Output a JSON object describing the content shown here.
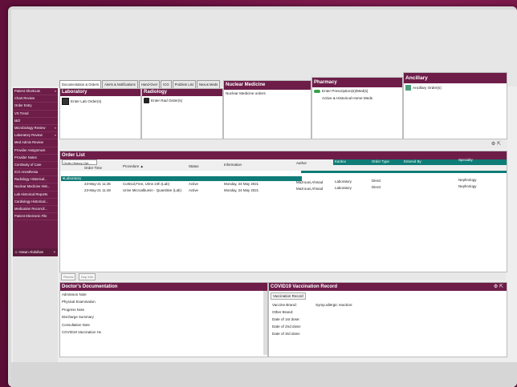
{
  "sidebar": {
    "items": [
      {
        "label": "Patient Shortcuts",
        "chev": "»"
      },
      {
        "label": "Chart Review"
      },
      {
        "label": "Order Entry"
      },
      {
        "label": "VS Trend"
      },
      {
        "label": "I&O"
      },
      {
        "label": "Microbiology Review",
        "chev": "»"
      },
      {
        "label": "Laboratory Review",
        "chev": "»"
      },
      {
        "label": "Med Admin Review"
      },
      {
        "label": "Provider Assignment"
      },
      {
        "label": "Provider Notes"
      },
      {
        "label": "Continuity of Care"
      },
      {
        "label": "ICG Anesthesia"
      },
      {
        "label": "Radiology Historical..."
      },
      {
        "label": "Nuclear Medicine Hist..."
      },
      {
        "label": "Lab Historical Reports"
      },
      {
        "label": "Cardiology Historical..."
      },
      {
        "label": "Medication Reconcil..."
      },
      {
        "label": "Patient Electronic File"
      }
    ],
    "patient": "Hasan Abdulbas",
    "patient_close": "×"
  },
  "tabs": [
    "Documentation & Orders",
    "Alerts & Notifications",
    "Hand-Over",
    "ICG",
    "Problem List",
    "Nexus Meds"
  ],
  "categories": {
    "laboratory": {
      "title": "Laboratory",
      "item": "Enter Lab Order(s)"
    },
    "radiology": {
      "title": "Radiology",
      "item": "Enter Rad Order(s)"
    },
    "nuclear": {
      "title": "Nuclear Medicine",
      "item": "Nuclear Medicine orders"
    },
    "pharmacy": {
      "title": "Pharmacy",
      "item1": "Enter Prescription(s)/Med(s)",
      "item2": "Active & Historical Home Meds"
    },
    "ancillary": {
      "title": "Ancillary",
      "item": "Ancillary Order(s)"
    }
  },
  "toolbar_icons": "⚙ ⇱",
  "order_list": {
    "title": "Order List",
    "filter": "Order History Opt...",
    "headers": {
      "order_time": "Order Time",
      "procedure": "Procedure ▲",
      "status": "Status",
      "information": "Information",
      "author": "Author",
      "kardex": "Kardex",
      "order_type": "Order Type",
      "entered_by": "Entered By",
      "specialty": "Specialty"
    },
    "group": "▾Laboratory",
    "rows": [
      {
        "time": "23-May-21 11:35",
        "procedure": "Cortisol,Free, Urine 24h (Lab)",
        "status": "Active",
        "info": "Monday, 24 May 2021",
        "author": "Mazrouei,Ahmad",
        "kardex": "Laboratory",
        "type": "Direct",
        "specialty": "Nephrology"
      },
      {
        "time": "23-May-21 11:48",
        "procedure": "Urine Microalbumin - Quantitive (Lab)",
        "status": "Active",
        "info": "Monday, 24 May 2021",
        "author": "Mazrouei,Ahmad",
        "kardex": "Laboratory",
        "type": "Direct",
        "specialty": "Nephrology"
      }
    ]
  },
  "bottom_buttons": [
    "Renew",
    "Dup Info"
  ],
  "doc": {
    "title": "Doctor's Documentation",
    "items": [
      "Admission Note",
      "Physical Examination",
      "Progress Note",
      "Discharge Summary",
      "Consultation Note",
      "COVID19 Vaccination Hx"
    ]
  },
  "covid": {
    "title": "COVID19 Vaccination Record",
    "tab": "Vaccination Record",
    "brand_label": "Vaccine Brand:",
    "allergic_label": "Symp.allergic reaction:",
    "other_brand": "Other Brand:",
    "dose1": "Date of 1st dose:",
    "dose2": "Date of 2nd dose:",
    "dose3": "Date of 3rd dose:"
  },
  "colors": {
    "brand": "#6e1d49",
    "teal": "#0f7c77",
    "background": "#6f1544"
  }
}
